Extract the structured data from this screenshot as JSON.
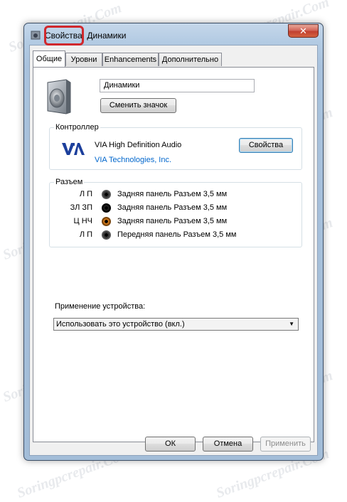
{
  "window": {
    "title": "Свойства: Динамики",
    "close_label": "✕"
  },
  "tabs": [
    {
      "label": "Общие",
      "active": true
    },
    {
      "label": "Уровни",
      "active": false
    },
    {
      "label": "Enhancements",
      "active": false
    },
    {
      "label": "Дополнительно",
      "active": false
    }
  ],
  "device": {
    "name_value": "Динамики",
    "change_icon_label": "Сменить значок"
  },
  "controller": {
    "group_label": "Контроллер",
    "name": "VIA High Definition Audio",
    "vendor_link": "VIA Technologies, Inc.",
    "properties_label": "Свойства"
  },
  "jacks": {
    "group_label": "Разъем",
    "items": [
      {
        "channel": "Л П",
        "description": "Задняя панель Разъем 3,5 мм",
        "color": "#1d1d1d"
      },
      {
        "channel": "ЗЛ ЗП",
        "description": "Задняя панель Разъем 3,5 мм",
        "color": "#000000"
      },
      {
        "channel": "Ц НЧ",
        "description": "Задняя панель Разъем 3,5 мм",
        "color": "#d07a1b"
      },
      {
        "channel": "Л П",
        "description": "Передняя панель Разъем 3,5 мм",
        "color": "#1d1d1d"
      }
    ]
  },
  "usage": {
    "label": "Применение устройства:",
    "selected": "Использовать это устройство (вкл.)"
  },
  "footer": {
    "ok_label": "ОК",
    "cancel_label": "Отмена",
    "apply_label": "Применить"
  },
  "watermark": "Soringpcrepair.Com",
  "colors": {
    "highlight": "#d0282d",
    "link": "#0066cc",
    "via_blue": "#1c3f9c"
  }
}
